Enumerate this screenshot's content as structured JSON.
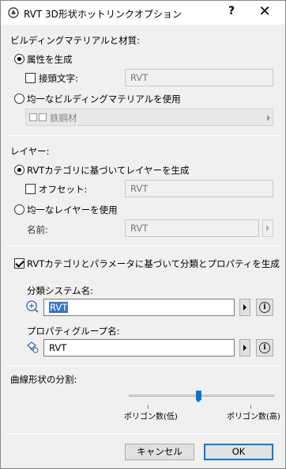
{
  "window": {
    "title": "RVT 3D形状ホットリンクオプション",
    "help": "?",
    "close": "✕"
  },
  "material": {
    "heading": "ビルディングマテリアルと材質:",
    "opt_generate": "属性を生成",
    "prefix_label": "接頭文字:",
    "prefix_value": "RVT",
    "opt_uniform": "均一なビルディングマテリアルを使用",
    "uniform_value": "鉄鋼材"
  },
  "layer": {
    "heading": "レイヤー:",
    "opt_generate": "RVTカテゴリに基づいてレイヤーを生成",
    "offset_label": "オフセット:",
    "offset_value": "RVT",
    "opt_uniform": "均一なレイヤーを使用",
    "name_label": "名前:",
    "name_value": "RVT"
  },
  "classification": {
    "checkbox_label": "RVTカテゴリとパラメータに基づいて分類とプロパティを生成",
    "system_label": "分類システム名:",
    "system_value": "RVT",
    "group_label": "プロパティグループ名:",
    "group_value": "RVT"
  },
  "curve": {
    "heading": "曲線形状の分割:",
    "low_label": "ポリゴン数(低)",
    "high_label": "ポリゴン数(高)",
    "slider_value": 0.48
  },
  "buttons": {
    "cancel": "キャンセル",
    "ok": "OK"
  },
  "colors": {
    "accent": "#0078d7",
    "selection": "#3b74c6"
  }
}
